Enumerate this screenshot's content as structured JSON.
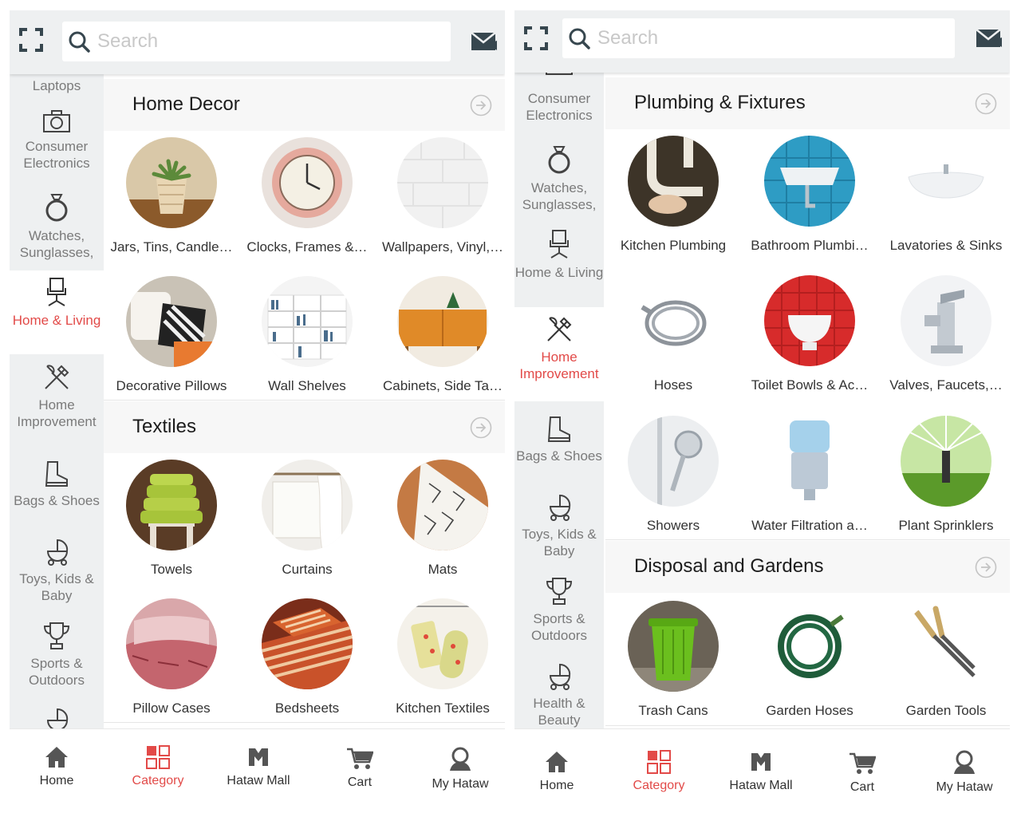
{
  "colors": {
    "accent": "#e24a48",
    "sidebar_bg": "#eef0f1",
    "icon_gray": "#555555"
  },
  "left": {
    "search": {
      "placeholder": "Search"
    },
    "sidebar": [
      {
        "label": "Laptops",
        "icon": "laptop-icon"
      },
      {
        "label": "Consumer Electronics",
        "icon": "camera-icon"
      },
      {
        "label": "Watches, Sunglasses,",
        "icon": "ring-icon"
      },
      {
        "label": "Home & Living",
        "icon": "chair-icon",
        "active": true
      },
      {
        "label": "Home Improvement",
        "icon": "tools-icon"
      },
      {
        "label": "Bags & Shoes",
        "icon": "boot-icon"
      },
      {
        "label": "Toys, Kids & Baby",
        "icon": "stroller-icon"
      },
      {
        "label": "Sports & Outdoors",
        "icon": "trophy-icon"
      }
    ],
    "sections": [
      {
        "title": "Home Decor",
        "items": [
          {
            "label": "Jars, Tins, Candle…",
            "icon": "succulent-jar-icon"
          },
          {
            "label": "Clocks, Frames &…",
            "icon": "wall-clock-icon"
          },
          {
            "label": "Wallpapers, Vinyl,…",
            "icon": "wallpaper-icon"
          },
          {
            "label": "Decorative Pillows",
            "icon": "pillows-icon"
          },
          {
            "label": "Wall Shelves",
            "icon": "bookshelf-icon"
          },
          {
            "label": "Cabinets, Side Ta…",
            "icon": "cabinet-icon"
          }
        ]
      },
      {
        "title": "Textiles",
        "items": [
          {
            "label": "Towels",
            "icon": "towels-icon"
          },
          {
            "label": "Curtains",
            "icon": "curtains-icon"
          },
          {
            "label": "Mats",
            "icon": "mat-icon"
          },
          {
            "label": "Pillow Cases",
            "icon": "pillow-case-icon"
          },
          {
            "label": "Bedsheets",
            "icon": "bedsheets-icon"
          },
          {
            "label": "Kitchen Textiles",
            "icon": "kitchen-textile-icon"
          }
        ]
      }
    ],
    "nav": [
      {
        "label": "Home",
        "icon": "home-icon"
      },
      {
        "label": "Category",
        "icon": "category-icon",
        "active": true
      },
      {
        "label": "Hataw Mall",
        "icon": "mall-icon"
      },
      {
        "label": "Cart",
        "icon": "cart-icon"
      },
      {
        "label": "My Hataw",
        "icon": "user-icon"
      }
    ]
  },
  "right": {
    "search": {
      "placeholder": "Search"
    },
    "sidebar": [
      {
        "label": "Consumer Electronics",
        "icon": "camera-icon"
      },
      {
        "label": "Watches, Sunglasses,",
        "icon": "ring-icon"
      },
      {
        "label": "Home & Living",
        "icon": "chair-icon"
      },
      {
        "label": "Home Improvement",
        "icon": "tools-icon",
        "active": true
      },
      {
        "label": "Bags & Shoes",
        "icon": "boot-icon"
      },
      {
        "label": "Toys, Kids & Baby",
        "icon": "stroller-icon"
      },
      {
        "label": "Sports & Outdoors",
        "icon": "trophy-icon"
      },
      {
        "label": "Health & Beauty",
        "icon": "stroller-icon"
      }
    ],
    "sections": [
      {
        "title": "Plumbing & Fixtures",
        "items": [
          {
            "label": "Kitchen Plumbing",
            "icon": "pipes-icon"
          },
          {
            "label": "Bathroom Plumbi…",
            "icon": "wall-sink-icon"
          },
          {
            "label": "Lavatories & Sinks",
            "icon": "basin-icon"
          },
          {
            "label": "Hoses",
            "icon": "shower-hose-icon"
          },
          {
            "label": "Toilet Bowls & Ac…",
            "icon": "toilet-icon"
          },
          {
            "label": "Valves, Faucets,…",
            "icon": "faucet-icon"
          },
          {
            "label": "Showers",
            "icon": "shower-head-icon"
          },
          {
            "label": "Water Filtration a…",
            "icon": "water-dispenser-icon"
          },
          {
            "label": "Plant Sprinklers",
            "icon": "sprinkler-icon"
          }
        ]
      },
      {
        "title": "Disposal and Gardens",
        "items": [
          {
            "label": "Trash Cans",
            "icon": "trash-can-icon"
          },
          {
            "label": "Garden Hoses",
            "icon": "garden-hose-icon"
          },
          {
            "label": "Garden Tools",
            "icon": "shears-icon"
          }
        ]
      }
    ],
    "nav": [
      {
        "label": "Home",
        "icon": "home-icon"
      },
      {
        "label": "Category",
        "icon": "category-icon",
        "active": true
      },
      {
        "label": "Hataw Mall",
        "icon": "mall-icon"
      },
      {
        "label": "Cart",
        "icon": "cart-icon"
      },
      {
        "label": "My Hataw",
        "icon": "user-icon"
      }
    ]
  }
}
